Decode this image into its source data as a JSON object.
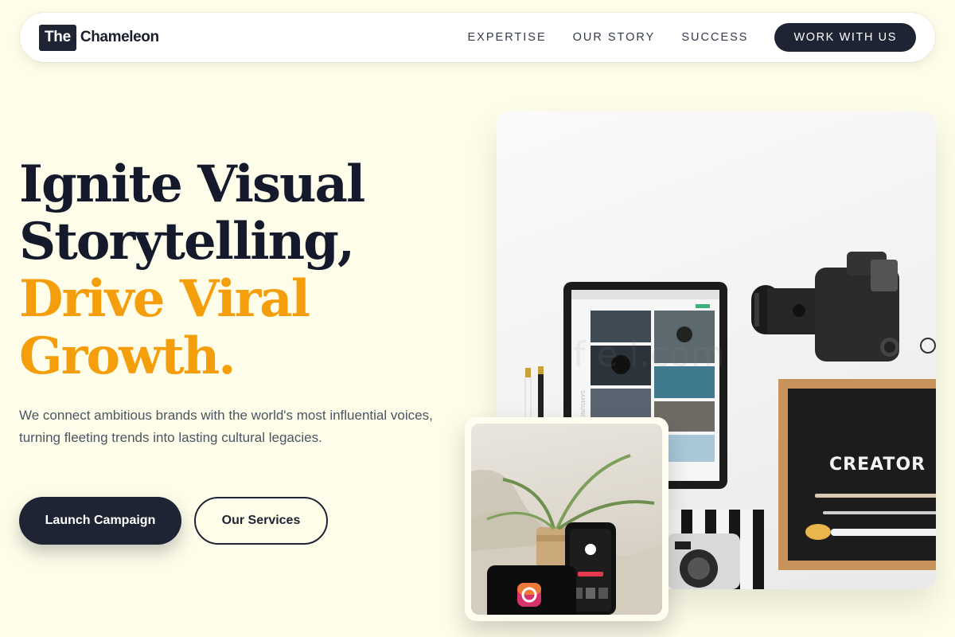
{
  "nav": {
    "logo_box": "The",
    "logo_text": "Chameleon",
    "links": [
      "EXPERTISE",
      "OUR STORY",
      "SUCCESS"
    ],
    "cta": "WORK WITH US"
  },
  "hero": {
    "headline_line1": "Ignite Visual",
    "headline_line2": "Storytelling,",
    "headline_line3": "Drive Viral",
    "headline_line4": "Growth.",
    "subtitle": "We connect ambitious brands with the world's most influential voices, turning fleeting trends into lasting cultural legacies.",
    "primary_button": "Launch Campaign",
    "secondary_button": "Our Services"
  },
  "images": {
    "letter_board_text": "CREATOR",
    "tablet_brand": "SAMSUNG"
  },
  "colors": {
    "background": "#fefde9",
    "primary": "#1e2433",
    "accent": "#f59e0b"
  }
}
